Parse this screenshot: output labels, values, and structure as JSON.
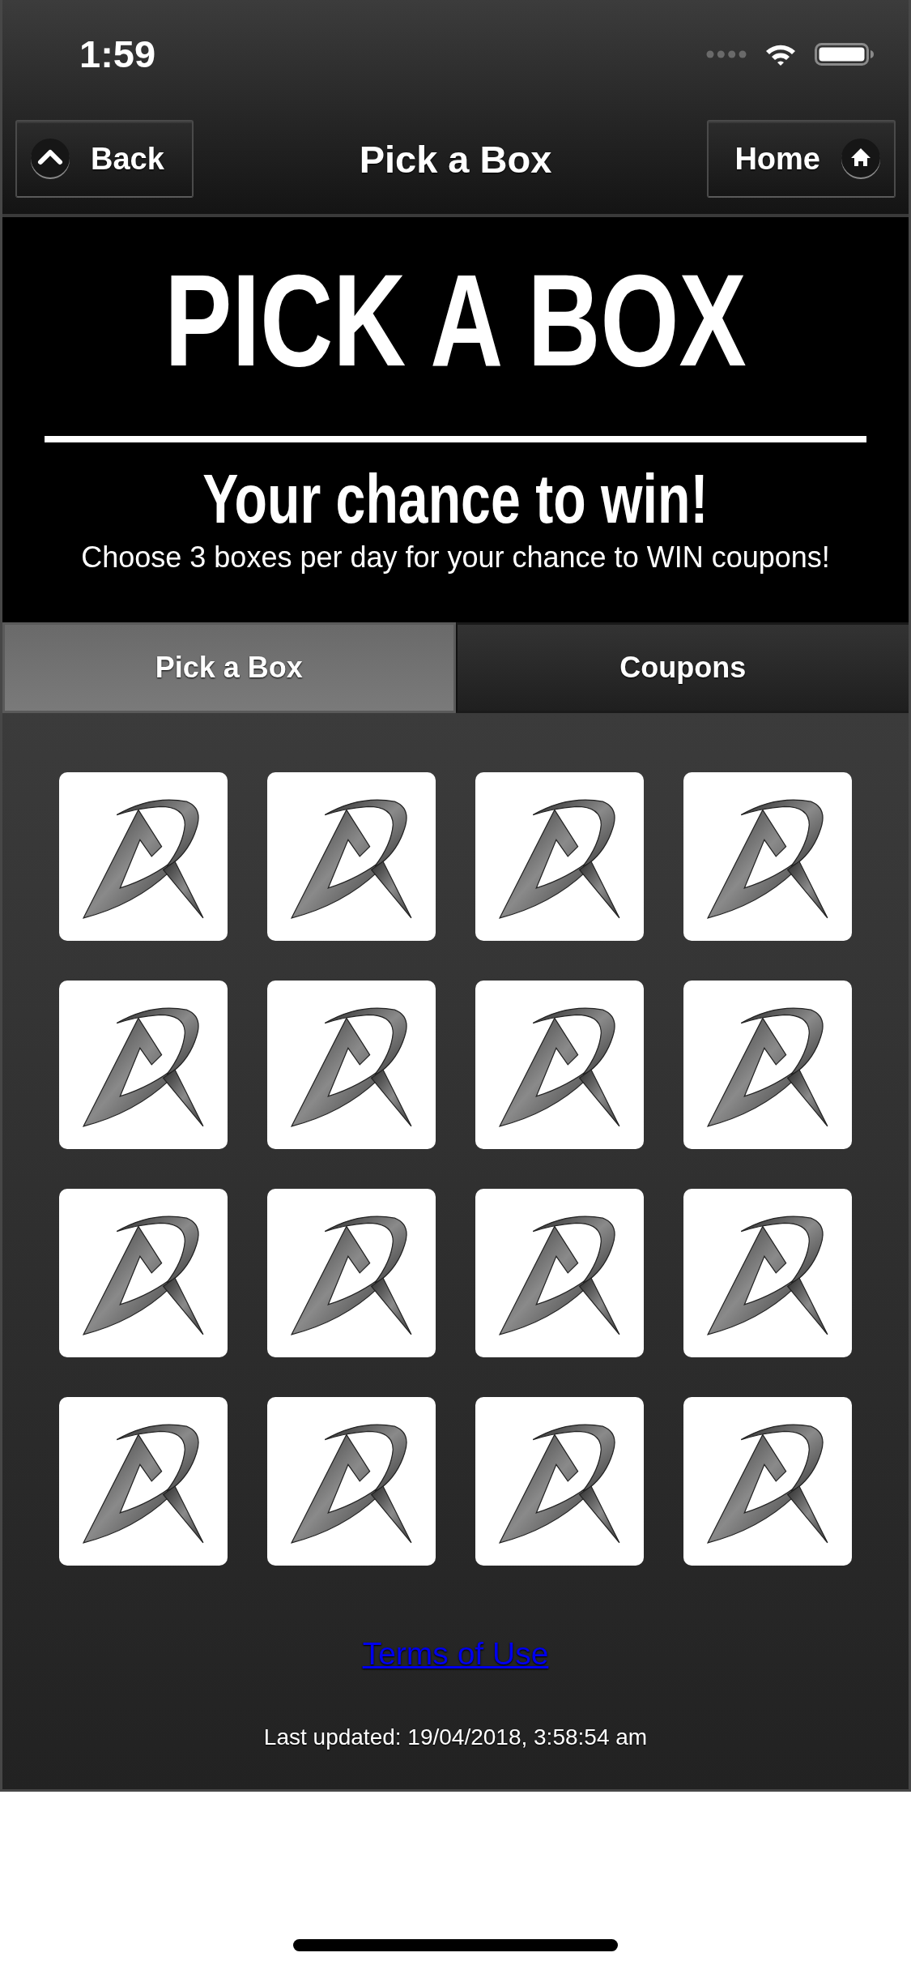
{
  "status_bar": {
    "time": "1:59"
  },
  "nav_bar": {
    "back_button": "Back",
    "title": "Pick a Box",
    "home_button": "Home"
  },
  "banner": {
    "title": "PICK A BOX",
    "subtitle": "Your chance to win!",
    "description": "Choose 3 boxes per day for your chance to WIN coupons!"
  },
  "tabs": [
    {
      "label": "Pick a Box",
      "selected": true
    },
    {
      "label": "Coupons",
      "selected": false
    }
  ],
  "boxes": [
    {
      "picked": false
    },
    {
      "picked": false
    },
    {
      "picked": false
    },
    {
      "picked": false
    },
    {
      "picked": false
    },
    {
      "picked": false
    },
    {
      "picked": false
    },
    {
      "picked": false
    },
    {
      "picked": false
    },
    {
      "picked": false
    },
    {
      "picked": false
    },
    {
      "picked": false
    },
    {
      "picked": false
    },
    {
      "picked": false
    },
    {
      "picked": false
    },
    {
      "picked": false
    }
  ],
  "footer": {
    "terms_link": "Terms of Use",
    "last_updated": "Last updated: 19/04/2018, 3:58:54 am"
  }
}
